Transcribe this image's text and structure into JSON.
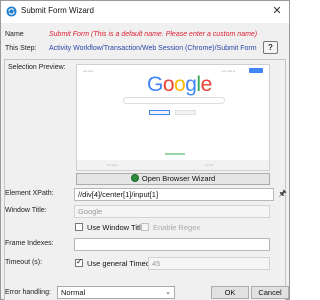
{
  "window": {
    "title": "Submit Form Wizard"
  },
  "name": {
    "label": "Name",
    "value": "Submit Form  (This is a default name. Please enter a custom name)"
  },
  "step": {
    "label": "This Step:",
    "value": "Activity Workflow/Transaction/Web Session (Chrome)/Submit Form",
    "help_label": "?"
  },
  "preview": {
    "label": "Selection Preview:",
    "logo_letters": [
      "G",
      "o",
      "o",
      "g",
      "l",
      "e"
    ]
  },
  "open_browser": {
    "label": "Open Browser Wizard"
  },
  "xpath": {
    "label": "Element XPath:",
    "value": "//div[4]/center[1]/input[1]"
  },
  "window_title": {
    "label": "Window Title:",
    "value": "Google"
  },
  "use_window_title": {
    "label": "Use Window Title"
  },
  "enable_regex": {
    "label": "Enable Regex"
  },
  "frame_indexes": {
    "label": "Frame Indexes:",
    "value": ""
  },
  "timeout": {
    "label": "Timeout (s):",
    "use_general_label": "Use general Timeout",
    "value": "45"
  },
  "error_handling": {
    "label": "Error handling:",
    "selected": "Normal"
  },
  "buttons": {
    "ok": "OK",
    "cancel": "Cancel"
  },
  "colors": {
    "name_value": "#dd2233",
    "step_link": "#2946a8",
    "google_blue": "#4285f4",
    "google_red": "#ea4335",
    "google_yellow": "#fbbc05",
    "google_green": "#34a853"
  }
}
